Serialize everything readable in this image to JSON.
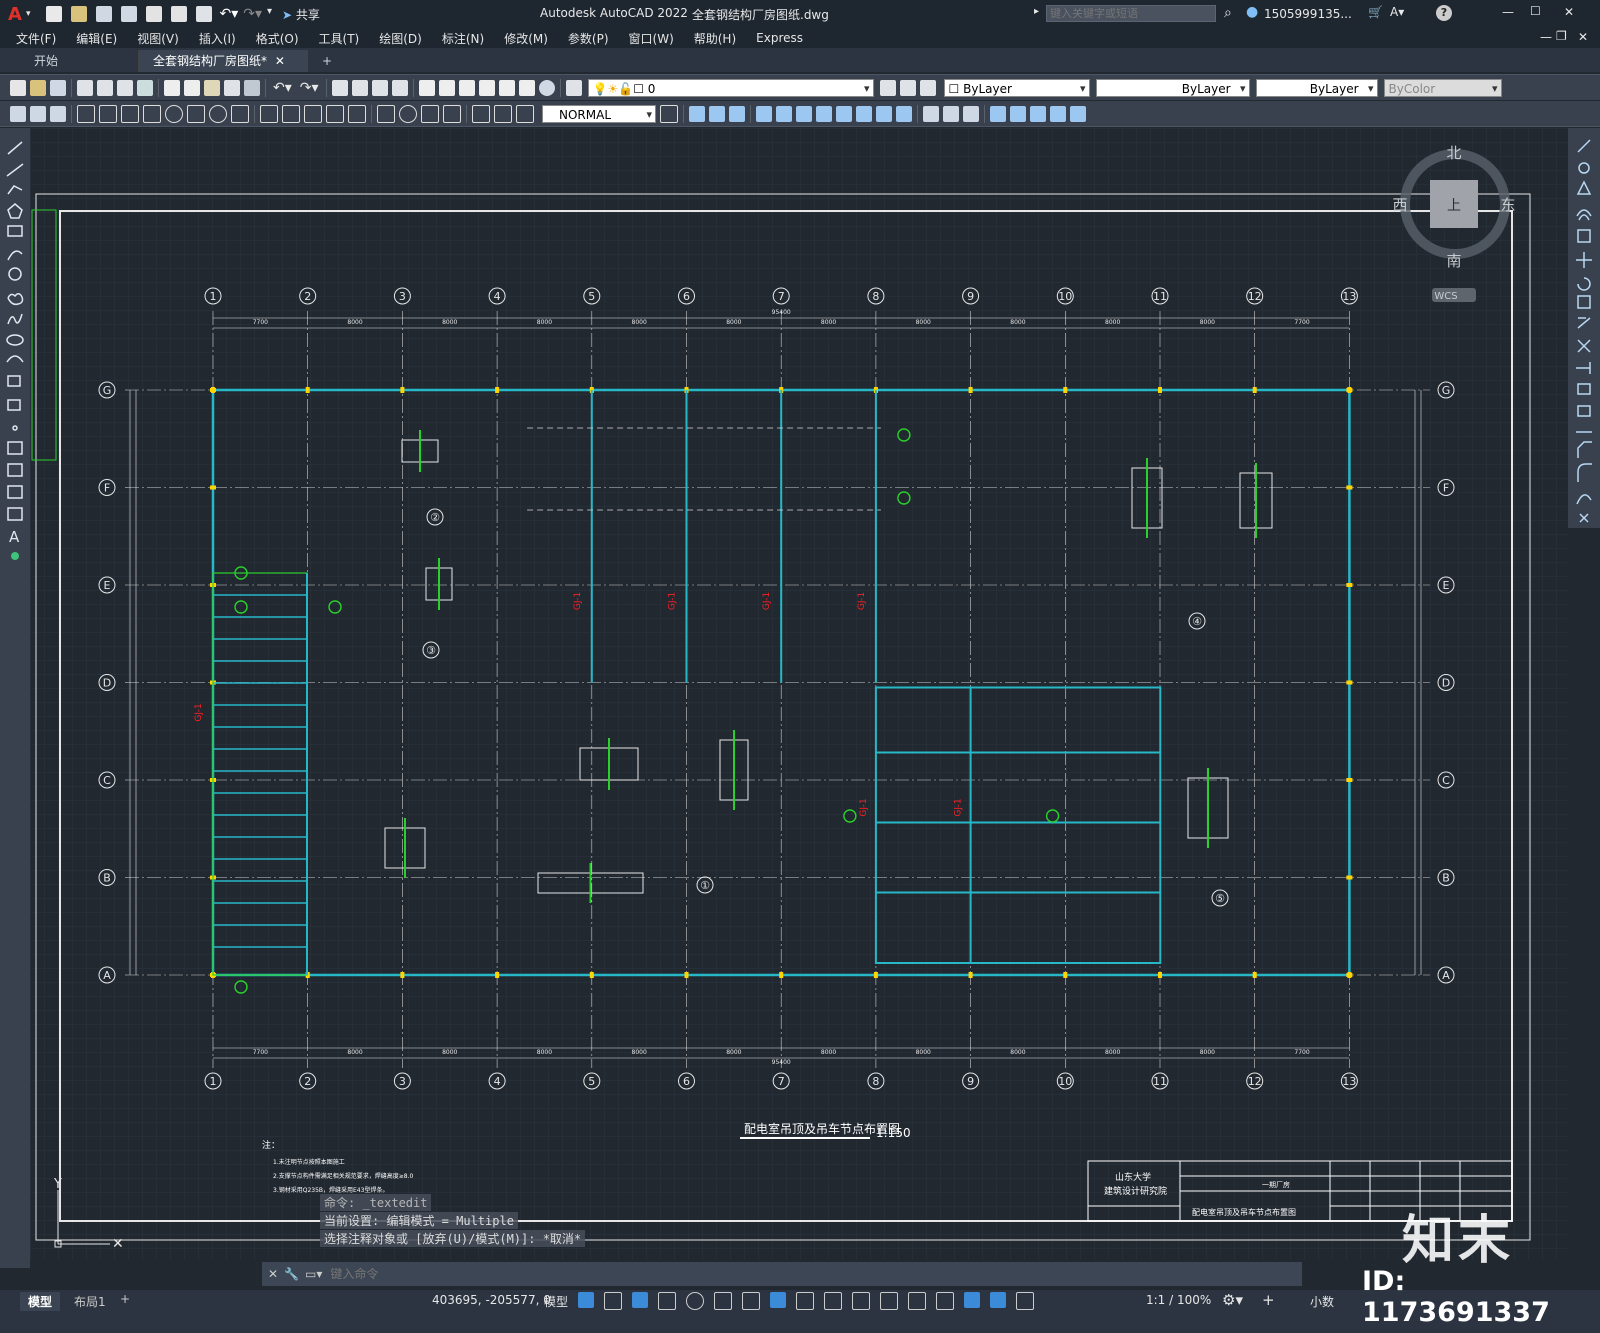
{
  "app": {
    "logo": "A",
    "title": "Autodesk AutoCAD 2022",
    "file_title": "全套钢结构厂房图纸.dwg",
    "share_label": "共享",
    "search_placeholder": "键入关键字或短语",
    "user": "1505999135...",
    "window_controls": [
      "—",
      "☐",
      "✕"
    ]
  },
  "menu": [
    "文件(F)",
    "编辑(E)",
    "视图(V)",
    "插入(I)",
    "格式(O)",
    "工具(T)",
    "绘图(D)",
    "标注(N)",
    "修改(M)",
    "参数(P)",
    "窗口(W)",
    "帮助(H)",
    "Express"
  ],
  "doc_tabs": [
    {
      "label": "开始",
      "active": false
    },
    {
      "label": "全套钢结构厂房图纸*",
      "active": true
    }
  ],
  "toolbar": {
    "layer_value": "0",
    "color_value": "ByLayer",
    "linetype_value": "ByLayer",
    "lineweight_value": "ByLayer",
    "plotstyle_value": "ByColor",
    "textstyle_value": "NORMAL"
  },
  "viewcube": {
    "north": "北",
    "south": "南",
    "west": "西",
    "east": "东",
    "top": "上",
    "wcs": "WCS"
  },
  "drawing": {
    "grid_cols": [
      "1",
      "2",
      "3",
      "4",
      "5",
      "6",
      "7",
      "8",
      "9",
      "10",
      "11",
      "12",
      "13"
    ],
    "grid_rows": [
      "G",
      "F",
      "E",
      "D",
      "C",
      "B",
      "A"
    ],
    "total_width_dim": "95400",
    "bay_dims": [
      "7700",
      "8000",
      "8000",
      "8000",
      "8000",
      "8000",
      "8000",
      "8000",
      "8000",
      "8000",
      "8000",
      "7700"
    ],
    "drawing_title": "配电室吊顶及吊车节点布置图",
    "scale": "1:150",
    "detail_numbers": [
      "①",
      "②",
      "③",
      "④",
      "⑤"
    ],
    "beam_labels": [
      "GJ-1",
      "GJ-1",
      "GJ-1",
      "GJ-1",
      "GJ-1",
      "GJ-1",
      "GJ-1"
    ],
    "notes_title": "注：",
    "notes": [
      "1.未注明节点按照本图施工",
      "2.支撑节点构件需满足相关规范要求，焊缝高度≥8.0",
      "3.钢材采用Q235B，焊缝采用E43型焊条。"
    ],
    "title_block": {
      "org": "山东大学",
      "org2": "建筑设计研究院",
      "project": "一期厂房",
      "sheet_name": "配电室吊顶及吊车节点布置图"
    }
  },
  "command_history": [
    "命令: _textedit",
    "当前设置: 编辑模式 = Multiple",
    "选择注释对象或 [放弃(U)/模式(M)]: *取消*"
  ],
  "command_placeholder": "键入命令",
  "layout_tabs": [
    "模型",
    "布局1"
  ],
  "status": {
    "coords": "403695, -205577, 0",
    "space": "模型",
    "scale": "1:1 / 100%",
    "units": "小数"
  },
  "watermark": {
    "brand": "知末",
    "id": "ID: 1173691337"
  }
}
